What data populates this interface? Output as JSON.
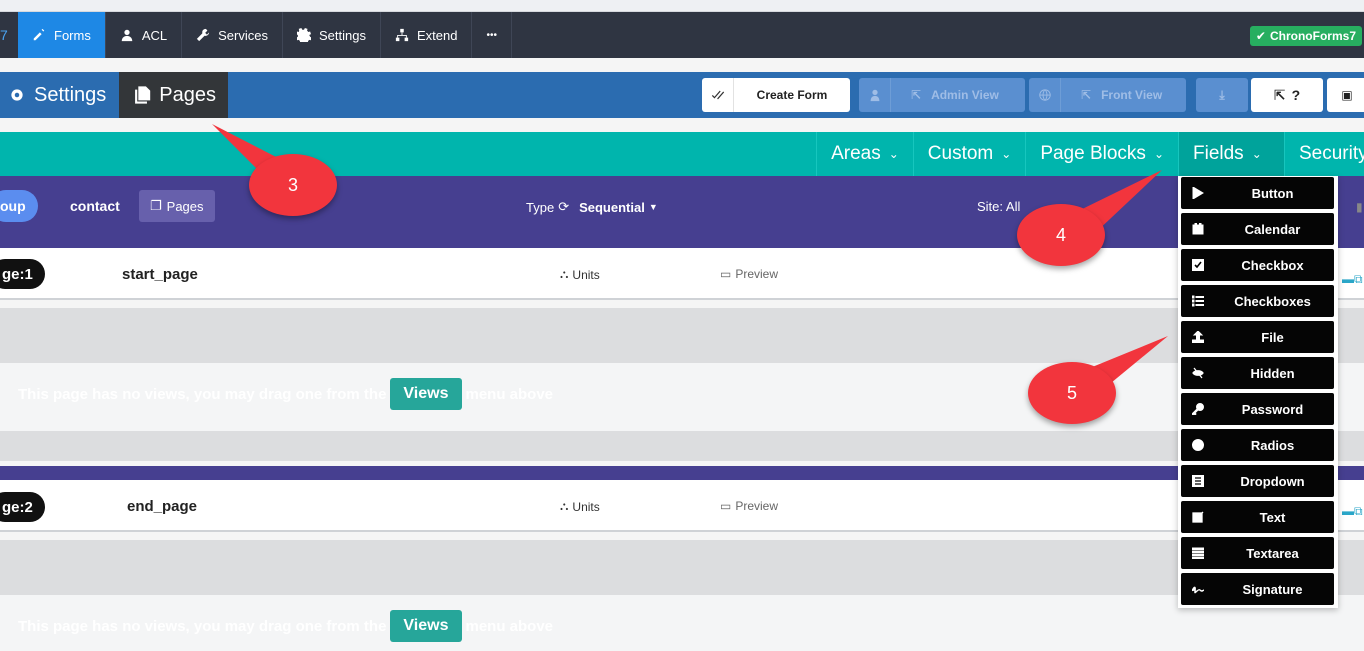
{
  "topnav": {
    "items": [
      {
        "label": "Forms",
        "icon": "edit-icon",
        "active": true
      },
      {
        "label": "ACL",
        "icon": "user-icon"
      },
      {
        "label": "Services",
        "icon": "wrench-icon"
      },
      {
        "label": "Settings",
        "icon": "gear-icon"
      },
      {
        "label": "Extend",
        "icon": "sitemap-icon"
      }
    ],
    "more": "•••",
    "badge": "ChronoForms7"
  },
  "toolbar": {
    "settings_label": "Settings",
    "pages_label": "Pages",
    "create_form": "Create Form",
    "admin_view": "Admin View",
    "front_view": "Front View",
    "help": "?"
  },
  "menu": {
    "items": [
      "Areas",
      "Custom",
      "Page Blocks",
      "Fields",
      "Security"
    ],
    "active": "Fields"
  },
  "header": {
    "group_pill": "oup",
    "form_name": "contact",
    "pages_btn": "Pages",
    "type_label": "Type",
    "type_value": "Sequential",
    "site_label": "Site: All"
  },
  "pages": [
    {
      "badge": "ge:1",
      "name": "start_page",
      "units": "Units",
      "preview": "Preview"
    },
    {
      "badge": "ge:2",
      "name": "end_page",
      "units": "Units",
      "preview": "Preview"
    }
  ],
  "empty": {
    "before": "This page has no views, you may drag one from the",
    "button": "Views",
    "after": "menu above"
  },
  "fields_dropdown": [
    {
      "label": "Button",
      "icon": "play-icon"
    },
    {
      "label": "Calendar",
      "icon": "calendar-icon"
    },
    {
      "label": "Checkbox",
      "icon": "checkbox-icon"
    },
    {
      "label": "Checkboxes",
      "icon": "tasks-icon"
    },
    {
      "label": "File",
      "icon": "upload-icon"
    },
    {
      "label": "Hidden",
      "icon": "eye-slash-icon"
    },
    {
      "label": "Password",
      "icon": "key-icon"
    },
    {
      "label": "Radios",
      "icon": "circle-icon"
    },
    {
      "label": "Dropdown",
      "icon": "list-icon"
    },
    {
      "label": "Text",
      "icon": "edit-icon"
    },
    {
      "label": "Textarea",
      "icon": "align-justify-icon"
    },
    {
      "label": "Signature",
      "icon": "signature-icon"
    }
  ],
  "callouts": [
    "3",
    "4",
    "5"
  ],
  "colors": {
    "callout": "#f2353d",
    "teal": "#00b5ad",
    "purple": "#463f90",
    "blue": "#2b6cb0",
    "nav": "#2f3542"
  }
}
